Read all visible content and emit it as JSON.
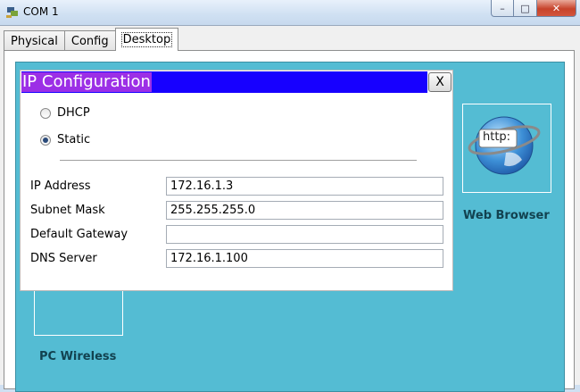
{
  "window": {
    "title": "COM 1",
    "min_symbol": "–",
    "max_symbol": "□",
    "close_symbol": "✕"
  },
  "tabs": [
    {
      "label": "Physical",
      "active": false
    },
    {
      "label": "Config",
      "active": false
    },
    {
      "label": "Desktop",
      "active": true
    }
  ],
  "desktop": {
    "web_browser": {
      "label": "Web Browser",
      "icon_text": "http:"
    },
    "pc_wireless": {
      "label": "PC Wireless"
    }
  },
  "ip_config": {
    "title": "IP Configuration",
    "close_label": "X",
    "dhcp_label": "DHCP",
    "static_label": "Static",
    "selected_mode": "Static",
    "fields": [
      {
        "label": "IP Address",
        "value": "172.16.1.3"
      },
      {
        "label": "Subnet Mask",
        "value": "255.255.255.0"
      },
      {
        "label": "Default Gateway",
        "value": ""
      },
      {
        "label": "DNS Server",
        "value": "172.16.1.100"
      }
    ]
  }
}
